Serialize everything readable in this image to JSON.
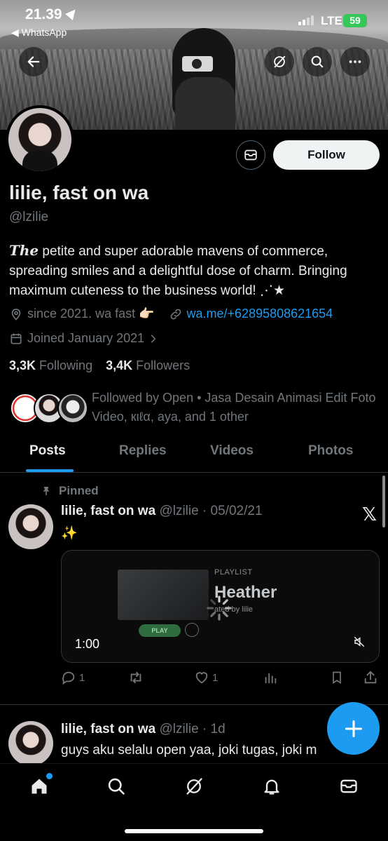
{
  "status_bar": {
    "time": "21.39",
    "back_app": "◀ WhatsApp",
    "network": "LTE",
    "battery": "59"
  },
  "profile": {
    "name": "lilie, fast on wa",
    "handle": "@lzilie",
    "bio_lead": "The",
    "bio_rest": " petite and super adorable mavens of commerce, spreading smiles and a delightful dose of charm. Bringing maximum cuteness to the business world! ⋰★",
    "location": "since 2021. wa fast 👉🏻",
    "website": "wa.me/+62895808621654",
    "joined": "Joined January 2021",
    "following_count": "3,3K",
    "following_label": "Following",
    "followers_count": "3,4K",
    "followers_label": "Followers",
    "followed_by": "Followed by Open • Jasa Desain Animasi Edit Foto Video, кιℓα, aya, and 1 other"
  },
  "buttons": {
    "follow": "Follow"
  },
  "tabs": [
    "Posts",
    "Replies",
    "Videos",
    "Photos"
  ],
  "active_tab": "Posts",
  "pinned_label": "Pinned",
  "posts": [
    {
      "author": "lilie, fast on wa",
      "handle_date": "@lzilie · 05/02/21",
      "text": "✨",
      "media": {
        "label": "PLAYLIST",
        "title": "Heather",
        "by": "ated by lilie",
        "play": "PLAY",
        "duration": "1:00"
      },
      "replies": "1",
      "likes": "1"
    },
    {
      "author": "lilie, fast on wa",
      "handle_date": "@lzilie · 1d",
      "text": "guys aku selalu open yaa, joki tugas, joki m"
    }
  ],
  "colors": {
    "accent": "#1d9bf0",
    "background": "#000000",
    "text_primary": "#e7e9ea",
    "text_secondary": "#71767b"
  }
}
